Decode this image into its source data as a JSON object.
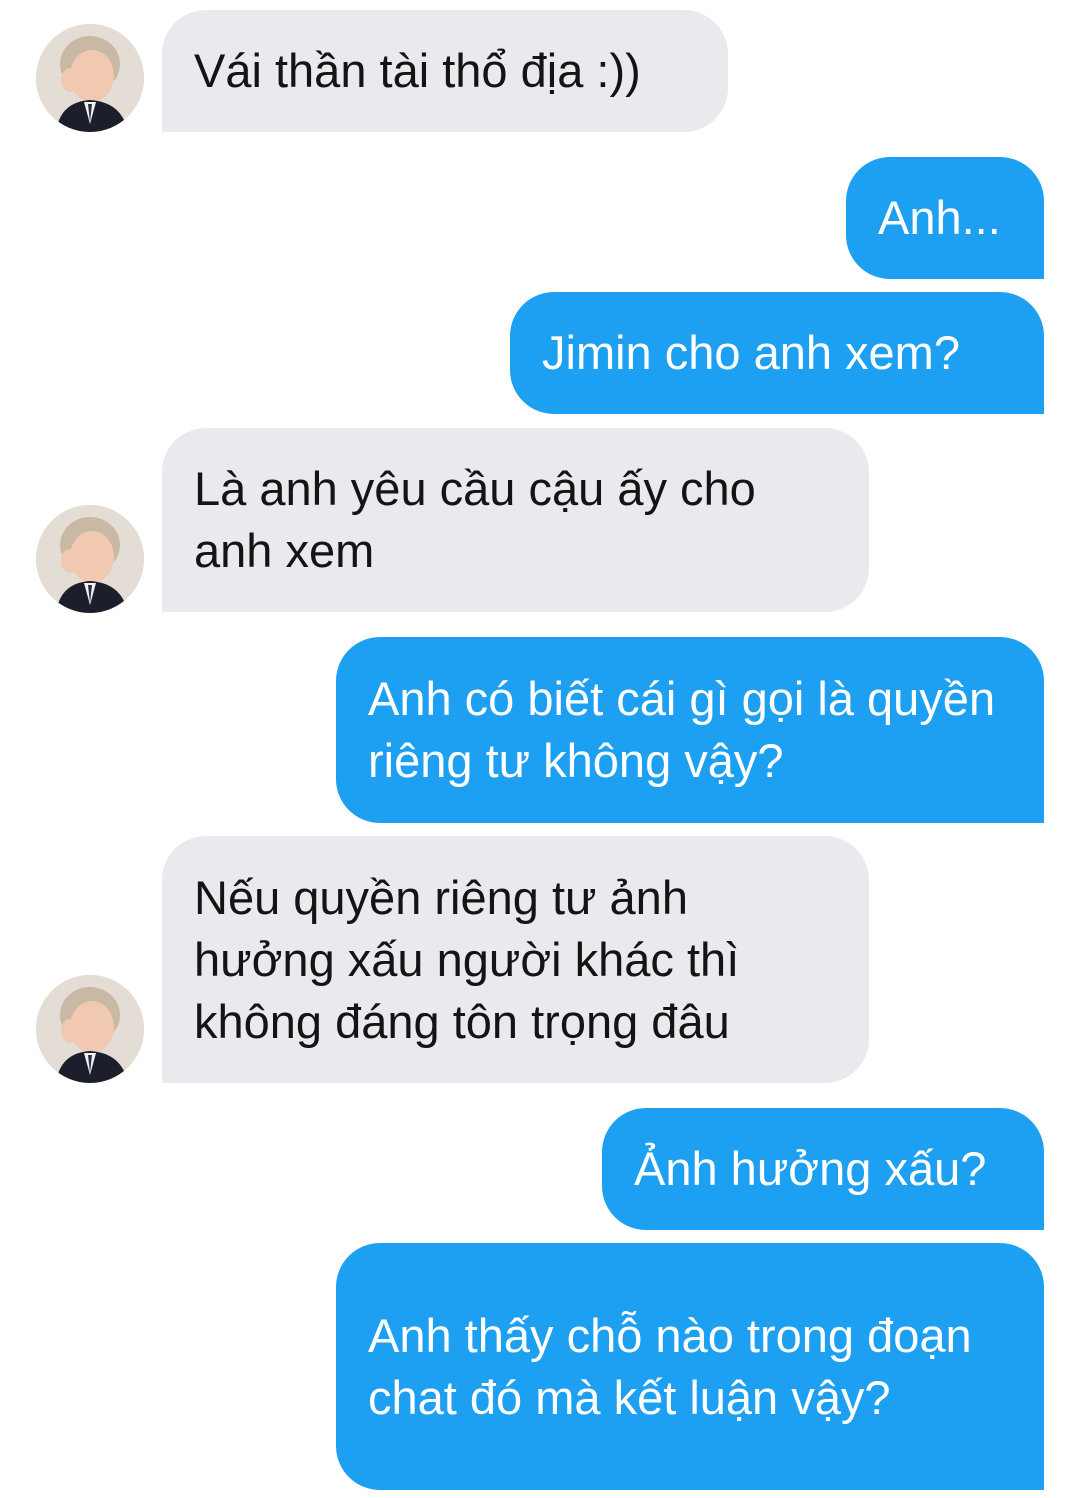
{
  "conversation": {
    "messages": [
      {
        "sender": "other",
        "text": "Vái thần tài thổ địa :))"
      },
      {
        "sender": "me",
        "text": "Anh..."
      },
      {
        "sender": "me",
        "text": "Jimin cho anh xem?"
      },
      {
        "sender": "other",
        "text": "Là anh yêu cầu cậu ấy cho anh xem"
      },
      {
        "sender": "me",
        "text": "Anh có biết cái gì gọi là quyền riêng tư không vậy?"
      },
      {
        "sender": "other",
        "text": "Nếu quyền riêng tư ảnh hưởng xấu người khác thì không đáng tôn trọng đâu"
      },
      {
        "sender": "me",
        "text": "Ảnh hưởng xấu?"
      },
      {
        "sender": "me",
        "text": "Anh thấy chỗ nào trong đoạn chat đó mà kết luận vậy?"
      }
    ]
  },
  "colors": {
    "outgoing_bubble": "#1da0f2",
    "incoming_bubble": "#e8eaed",
    "outgoing_text": "#ffffff",
    "incoming_text": "#141414"
  }
}
